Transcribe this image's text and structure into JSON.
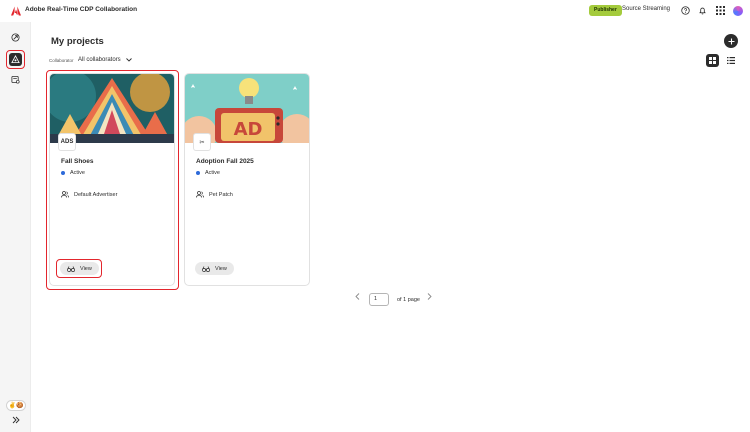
{
  "header": {
    "app_title": "Adobe Real-Time CDP Collaboration",
    "badge": "Publisher",
    "source": "Source Streaming",
    "icons": [
      "help-icon",
      "bell-icon",
      "apps-grid-icon",
      "avatar"
    ]
  },
  "rail": {
    "items": [
      "insights-icon",
      "projects-icon",
      "audiences-icon"
    ],
    "active_index": 1,
    "feedback_emoji": "✌️🍪"
  },
  "main": {
    "title": "My projects",
    "filter": {
      "label": "Collaborator",
      "value": "All collaborators"
    }
  },
  "cards": [
    {
      "title": "Fall Shoes",
      "status": "Active",
      "owner": "Default Advertiser",
      "logo": "ADS",
      "button": "View"
    },
    {
      "title": "Adoption Fall 2025",
      "status": "Active",
      "owner": "Pet Patch",
      "logo": "✂︎",
      "button": "View"
    }
  ],
  "pagination": {
    "current": "1",
    "total_text": "of 1 page"
  },
  "colors": {
    "accent_red": "#e3262d",
    "badge_green": "#a4cb3c",
    "status_blue": "#2d6ad9"
  }
}
